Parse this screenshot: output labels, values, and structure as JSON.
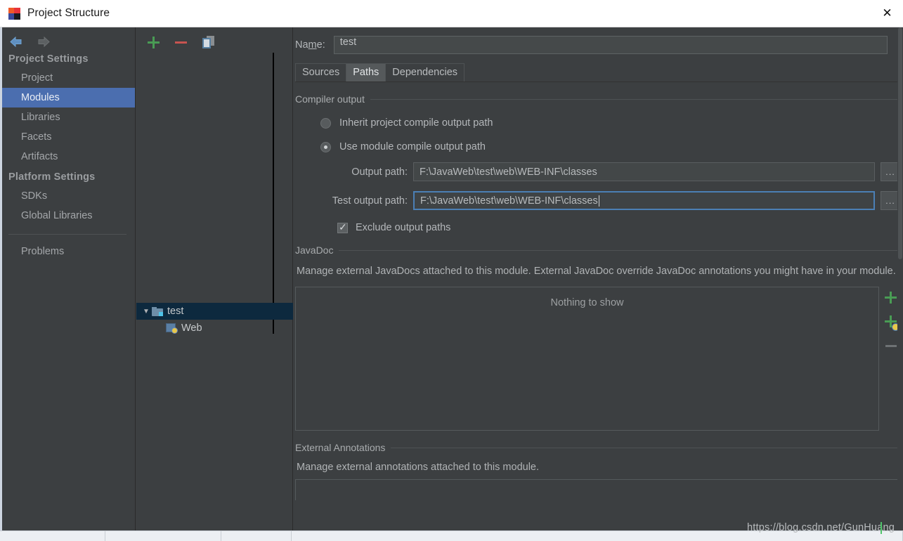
{
  "window": {
    "title": "Project Structure",
    "app_icon": "intellij-idea-icon",
    "close_label": "✕"
  },
  "nav": {
    "back_icon": "arrow-left-icon",
    "forward_icon": "arrow-right-icon"
  },
  "sidebar": {
    "groups": [
      {
        "label": "Project Settings",
        "items": [
          {
            "label": "Project",
            "selected": false
          },
          {
            "label": "Modules",
            "selected": true
          },
          {
            "label": "Libraries",
            "selected": false
          },
          {
            "label": "Facets",
            "selected": false
          },
          {
            "label": "Artifacts",
            "selected": false
          }
        ]
      },
      {
        "label": "Platform Settings",
        "items": [
          {
            "label": "SDKs",
            "selected": false
          },
          {
            "label": "Global Libraries",
            "selected": false
          }
        ]
      }
    ],
    "problems_label": "Problems",
    "selected_color": "#4b6eaf"
  },
  "module_panel": {
    "toolbar": {
      "add_icon": "plus-icon",
      "remove_icon": "minus-icon",
      "copy_icon": "copy-icon"
    },
    "tree": [
      {
        "label": "test",
        "icon": "module-folder-icon",
        "selected": true,
        "expanded": true,
        "toggle": "▼"
      },
      {
        "label": "Web",
        "icon": "web-facet-icon",
        "selected": false,
        "child": true
      }
    ]
  },
  "main": {
    "name_label_pre": "Na",
    "name_label_mnemonic": "m",
    "name_label_post": "e:",
    "name_value": "test",
    "tabs": [
      {
        "label": "Sources",
        "active": false
      },
      {
        "label": "Paths",
        "active": true
      },
      {
        "label": "Dependencies",
        "active": false
      }
    ],
    "compiler_output": {
      "section_title": "Compiler output",
      "radio_inherit": "Inherit project compile output path",
      "radio_module": "Use module compile output path",
      "radio_selected": "module",
      "output_path_label": "Output path:",
      "output_path_value": "F:\\JavaWeb\\test\\web\\WEB-INF\\classes",
      "test_output_path_label": "Test output path:",
      "test_output_path_value": "F:\\JavaWeb\\test\\web\\WEB-INF\\classes",
      "browse_label": "...",
      "exclude_label": "Exclude output paths",
      "exclude_checked": true
    },
    "javadoc": {
      "section_title": "JavaDoc",
      "description": "Manage external JavaDocs attached to this module. External JavaDoc override JavaDoc annotations you might have in your module.",
      "empty_text": "Nothing to show",
      "buttons": [
        {
          "icon": "add-path-icon"
        },
        {
          "icon": "add-url-icon"
        },
        {
          "icon": "remove-icon"
        }
      ]
    },
    "external_annotations": {
      "section_title": "External Annotations",
      "description": "Manage external annotations attached to this module."
    }
  },
  "watermark": {
    "text": "https://blog.csdn.net/GunHuang"
  },
  "colors": {
    "background": "#3c3f41",
    "accent": "#4b6eaf",
    "tree_selected": "#0d293e",
    "focus_border": "#4b7fb5",
    "green": "#499c54",
    "red": "#c75450"
  }
}
